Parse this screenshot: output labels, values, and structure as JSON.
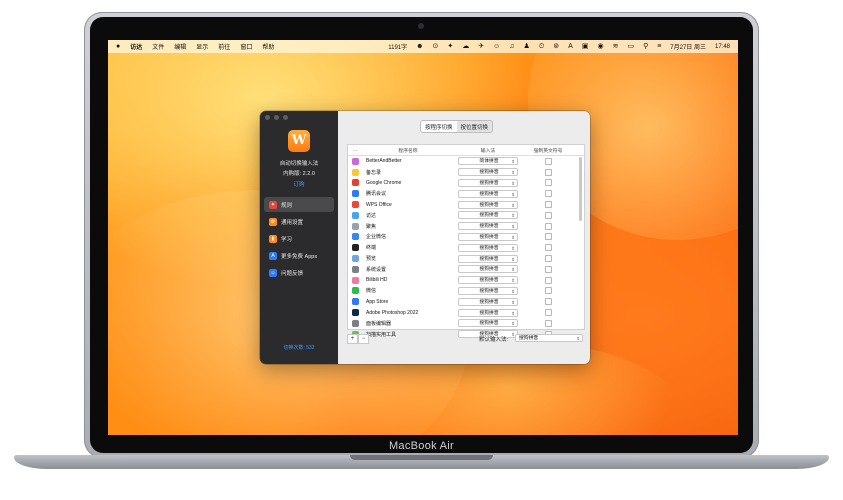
{
  "device": {
    "brand_label": "MacBook Air"
  },
  "menubar": {
    "apple": "",
    "items": [
      "访达",
      "文件",
      "编辑",
      "显示",
      "前往",
      "窗口",
      "帮助"
    ],
    "status_text": "1191字",
    "status_icons": [
      "☻",
      "⊙",
      "✦",
      "☁",
      "✈",
      "☺",
      "♫",
      "♟",
      "⏲",
      "⊚",
      "A",
      "▣",
      "◉",
      "≋",
      "▭",
      "⚲",
      "≡"
    ],
    "date": "7月27日 周三",
    "time": "17:48"
  },
  "app": {
    "logo_letter": "W",
    "name": "自动切换输入法",
    "version": "内购版: 2.2.0",
    "subscribe": "订购",
    "nav": [
      {
        "label": "规则",
        "icon": "rules-icon",
        "color": "#e8463a"
      },
      {
        "label": "通用设置",
        "icon": "gear-icon",
        "color": "#ff8a1c"
      },
      {
        "label": "学习",
        "icon": "book-icon",
        "color": "#ff8a1c"
      },
      {
        "label": "更多免费 Apps",
        "icon": "app-store-icon",
        "color": "#2f7bf5"
      },
      {
        "label": "问题反馈",
        "icon": "people-icon",
        "color": "#2f7bf5"
      }
    ],
    "switch_count": "切换次数: 532"
  },
  "tabs": [
    "按程序切换",
    "按位置切换"
  ],
  "table": {
    "headers": [
      "...",
      "程序名称",
      "输入法",
      "强制英文符号"
    ],
    "rows": [
      {
        "name": "BetterAndBetter",
        "ime": "简体拼音",
        "icon_color": "#c86ad8"
      },
      {
        "name": "备忘录",
        "ime": "搜狗拼音",
        "icon_color": "#f5c93a"
      },
      {
        "name": "Google Chrome",
        "ime": "搜狗拼音",
        "icon_color": "#e3422f"
      },
      {
        "name": "腾讯会议",
        "ime": "搜狗拼音",
        "icon_color": "#2f7bf5"
      },
      {
        "name": "WPS Office",
        "ime": "搜狗拼音",
        "icon_color": "#e64a3a"
      },
      {
        "name": "访达",
        "ime": "搜狗拼音",
        "icon_color": "#4aa3f0"
      },
      {
        "name": "聚焦",
        "ime": "搜狗拼音",
        "icon_color": "#9aa0a8"
      },
      {
        "name": "企业微信",
        "ime": "搜狗拼音",
        "icon_color": "#3a86f0"
      },
      {
        "name": "终端",
        "ime": "搜狗拼音",
        "icon_color": "#222222"
      },
      {
        "name": "预览",
        "ime": "搜狗拼音",
        "icon_color": "#6fa5e0"
      },
      {
        "name": "系统设置",
        "ime": "搜狗拼音",
        "icon_color": "#7c7f86"
      },
      {
        "name": "Bilibili HD",
        "ime": "搜狗拼音",
        "icon_color": "#f07aa4"
      },
      {
        "name": "微信",
        "ime": "搜狗拼音",
        "icon_color": "#2dbb4e"
      },
      {
        "name": "App Store",
        "ime": "搜狗拼音",
        "icon_color": "#2f7bf5"
      },
      {
        "name": "Adobe Photoshop 2022",
        "ime": "搜狗拼音",
        "icon_color": "#0c2a4e"
      },
      {
        "name": "面板编辑器",
        "ime": "搜狗拼音",
        "icon_color": "#7c7f86"
      },
      {
        "name": "扫描实用工具",
        "ime": "搜狗拼音",
        "icon_color": "#6dbd5a"
      }
    ]
  },
  "footer": {
    "add": "+",
    "remove": "−",
    "default_label": "默认输入法:",
    "default_value": "搜狗拼音"
  }
}
